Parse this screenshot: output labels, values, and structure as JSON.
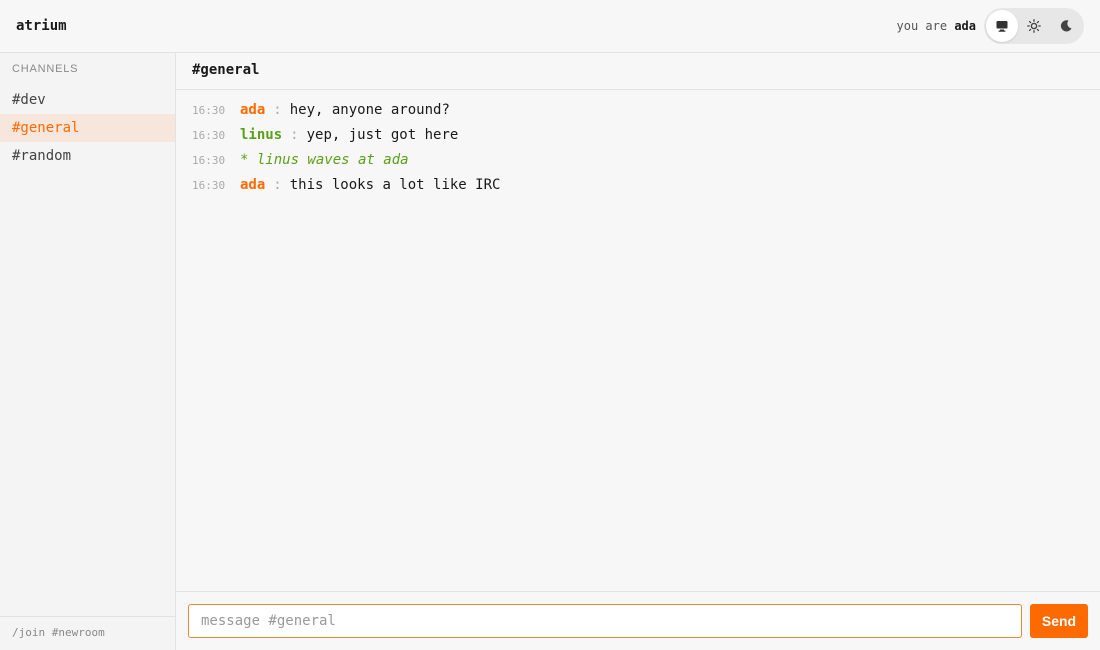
{
  "app": {
    "title": "atrium"
  },
  "user": {
    "prefix": "you are",
    "name": "ada"
  },
  "theme": {
    "options": [
      {
        "icon": "monitor-icon",
        "label": "system",
        "active": true
      },
      {
        "icon": "sun-icon",
        "label": "light",
        "active": false
      },
      {
        "icon": "moon-icon",
        "label": "dark",
        "active": false
      }
    ]
  },
  "sidebar": {
    "heading": "CHANNELS",
    "channels": [
      {
        "label": "#dev",
        "active": false
      },
      {
        "label": "#general",
        "active": true
      },
      {
        "label": "#random",
        "active": false
      }
    ],
    "footer_hint": "/join #newroom"
  },
  "channel": {
    "name": "#general"
  },
  "messages": [
    {
      "time": "16:30",
      "nick": "ada",
      "text": "hey, anyone around?",
      "type": "message"
    },
    {
      "time": "16:30",
      "nick": "linus",
      "text": "yep, just got here",
      "type": "message"
    },
    {
      "time": "16:30",
      "text": "* linus waves at ada",
      "type": "action"
    },
    {
      "time": "16:30",
      "nick": "ada",
      "text": "this looks a lot like IRC",
      "type": "message"
    }
  ],
  "composer": {
    "placeholder": "message #general",
    "value": "",
    "send_label": "Send"
  },
  "colors": {
    "accent": "#ff6a00",
    "nick_ada": "#ff6a00",
    "nick_linus": "#5aa01a",
    "action": "#5aa01a"
  }
}
